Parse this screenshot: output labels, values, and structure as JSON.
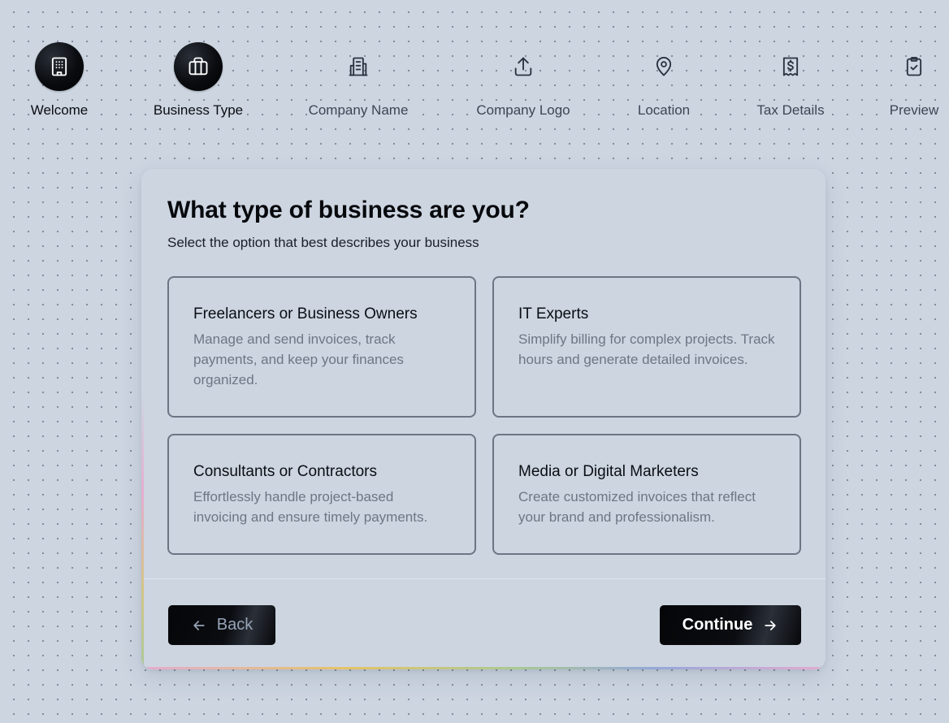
{
  "stepper": {
    "steps": [
      {
        "label": "Welcome",
        "icon": "building-icon",
        "state": "completed"
      },
      {
        "label": "Business Type",
        "icon": "briefcase-icon",
        "state": "current"
      },
      {
        "label": "Company Name",
        "icon": "office-building-icon",
        "state": "upcoming"
      },
      {
        "label": "Company Logo",
        "icon": "upload-icon",
        "state": "upcoming"
      },
      {
        "label": "Location",
        "icon": "map-pin-icon",
        "state": "upcoming"
      },
      {
        "label": "Tax Details",
        "icon": "receipt-dollar-icon",
        "state": "upcoming"
      },
      {
        "label": "Preview",
        "icon": "clipboard-check-icon",
        "state": "upcoming"
      }
    ]
  },
  "card": {
    "title": "What type of business are you?",
    "subtitle": "Select the option that best describes your business",
    "options": [
      {
        "title": "Freelancers or Business Owners",
        "description": "Manage and send invoices, track payments, and keep your finances organized."
      },
      {
        "title": "IT Experts",
        "description": "Simplify billing for complex projects. Track hours and generate detailed invoices."
      },
      {
        "title": "Consultants or Contractors",
        "description": "Effortlessly handle project-based invoicing and ensure timely payments."
      },
      {
        "title": "Media or Digital Marketers",
        "description": "Create customized invoices that reflect your brand and professionalism."
      }
    ]
  },
  "actions": {
    "back_label": "Back",
    "back_icon": "arrow-left-icon",
    "continue_label": "Continue",
    "continue_icon": "arrow-right-icon"
  },
  "colors": {
    "background": "#ccd5e0",
    "active_step": "#0a0c10",
    "option_border": "#6c7583",
    "muted_text": "#6d7683"
  }
}
